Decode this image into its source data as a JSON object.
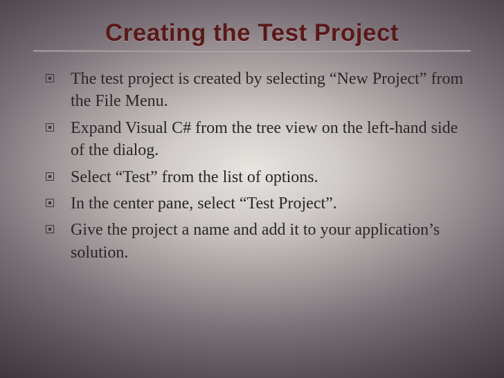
{
  "title": "Creating the Test Project",
  "bullets": [
    "The test project is created by selecting “New Project” from the File Menu.",
    "Expand Visual C# from the tree view on the left-hand side of the dialog.",
    "Select “Test” from the list of options.",
    "In the center pane, select “Test Project”.",
    "Give the project a name and add it to your application’s solution."
  ]
}
